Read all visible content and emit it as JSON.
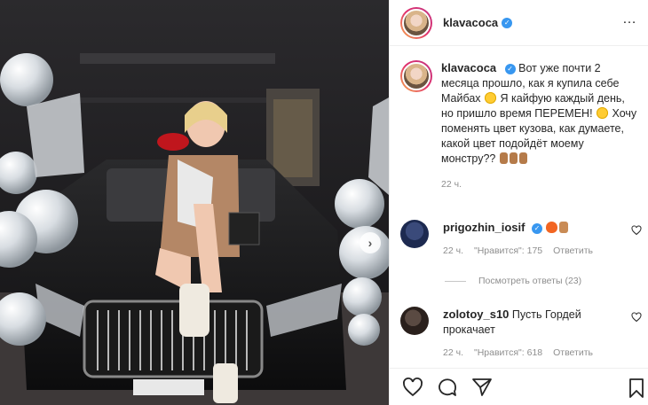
{
  "post": {
    "author": "klavacoca",
    "verified_mark": "✓"
  },
  "caption": {
    "text_1": "Вот уже почти 2 месяца прошло, как я купила себе Майбах",
    "text_2": "Я кайфую каждый день, но пришло время ПЕРЕМЕН!",
    "text_3": "Хочу поменять цвет кузова, как думаете, какой цвет подойдёт моему монстру??",
    "time": "22 ч."
  },
  "comments": [
    {
      "username": "prigozhin_iosif",
      "text": "",
      "time": "22 ч.",
      "likes": "\"Нравится\": 175",
      "reply": "Ответить"
    },
    {
      "username": "zolotoy_s10",
      "text": "Пусть Гордей прокачает",
      "time": "22 ч.",
      "likes": "\"Нравится\": 618",
      "reply": "Ответить"
    }
  ],
  "replies_toggle": "Посмотреть ответы (23)",
  "icons": {
    "like": "heart-icon",
    "comment": "comment-icon",
    "share": "share-icon",
    "save": "bookmark-icon",
    "next": "chevron-right-icon"
  },
  "colors": {
    "verified": "#3897f0",
    "meta_text": "#8e8e8e",
    "primary_text": "#262626"
  }
}
